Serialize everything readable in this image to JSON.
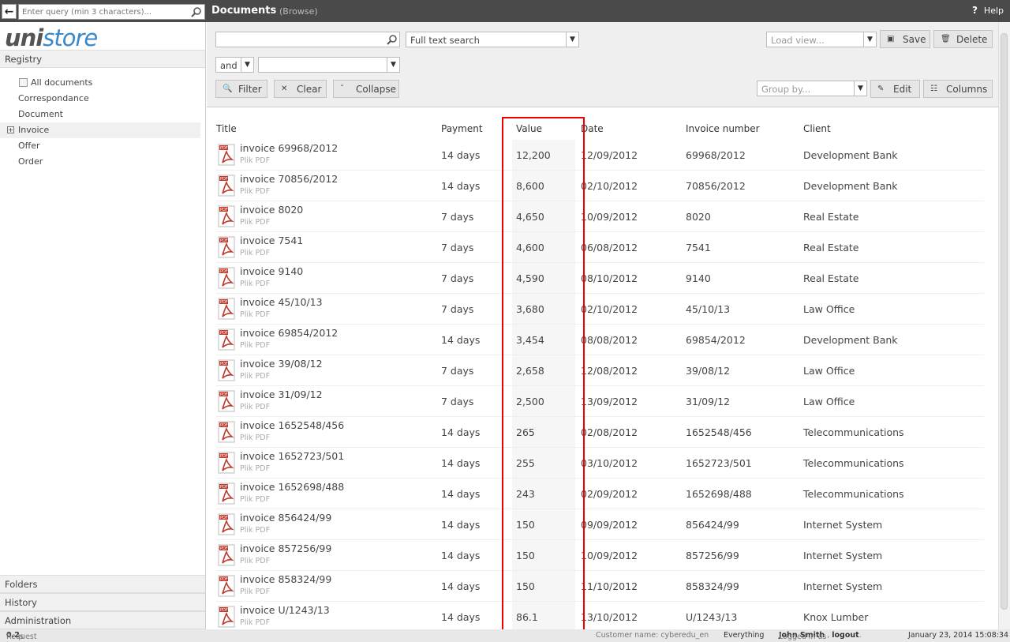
{
  "topbar": {
    "search_placeholder": "Enter query (min 3 characters)...",
    "title": "Documents",
    "subtitle": "(Browse)",
    "help": "Help"
  },
  "sidebar": {
    "logo_uni": "uni",
    "logo_store": "store",
    "registry_label": "Registry",
    "tree": [
      {
        "label": "All documents"
      },
      {
        "label": "Correspondance"
      },
      {
        "label": "Document"
      },
      {
        "label": "Invoice"
      },
      {
        "label": "Offer"
      },
      {
        "label": "Order"
      }
    ],
    "folders_label": "Folders",
    "history_label": "History",
    "administration_label": "Administration"
  },
  "toolbar": {
    "search_mode": "Full text search",
    "operator": "and",
    "filter_label": "Filter",
    "clear_label": "Clear",
    "collapse_label": "Collapse",
    "load_view_placeholder": "Load view...",
    "save_label": "Save",
    "delete_label": "Delete",
    "group_by_placeholder": "Group by...",
    "edit_label": "Edit",
    "columns_label": "Columns"
  },
  "table": {
    "columns": [
      "Title",
      "Payment",
      "Value",
      "Date",
      "Invoice number",
      "Client"
    ],
    "rows": [
      {
        "title": "invoice 69968/2012",
        "sub": "Plik PDF",
        "payment": "14 days",
        "value": "12,200",
        "date": "12/09/2012",
        "number": "69968/2012",
        "client": "Development Bank"
      },
      {
        "title": "invoice 70856/2012",
        "sub": "Plik PDF",
        "payment": "14 days",
        "value": "8,600",
        "date": "02/10/2012",
        "number": "70856/2012",
        "client": "Development Bank"
      },
      {
        "title": "invoice 8020",
        "sub": "Plik PDF",
        "payment": "7 days",
        "value": "4,650",
        "date": "10/09/2012",
        "number": "8020",
        "client": "Real Estate"
      },
      {
        "title": "invoice 7541",
        "sub": "Plik PDF",
        "payment": "7 days",
        "value": "4,600",
        "date": "06/08/2012",
        "number": "7541",
        "client": "Real Estate"
      },
      {
        "title": "invoice 9140",
        "sub": "Plik PDF",
        "payment": "7 days",
        "value": "4,590",
        "date": "08/10/2012",
        "number": "9140",
        "client": "Real Estate"
      },
      {
        "title": "invoice 45/10/13",
        "sub": "Plik PDF",
        "payment": "7 days",
        "value": "3,680",
        "date": "02/10/2012",
        "number": "45/10/13",
        "client": "Law Office"
      },
      {
        "title": "invoice 69854/2012",
        "sub": "Plik PDF",
        "payment": "14 days",
        "value": "3,454",
        "date": "08/08/2012",
        "number": "69854/2012",
        "client": "Development Bank"
      },
      {
        "title": "invoice 39/08/12",
        "sub": "Plik PDF",
        "payment": "7 days",
        "value": "2,658",
        "date": "12/08/2012",
        "number": "39/08/12",
        "client": "Law Office"
      },
      {
        "title": "invoice 31/09/12",
        "sub": "Plik PDF",
        "payment": "7 days",
        "value": "2,500",
        "date": "13/09/2012",
        "number": "31/09/12",
        "client": "Law Office"
      },
      {
        "title": "invoice 1652548/456",
        "sub": "Plik PDF",
        "payment": "14 days",
        "value": "265",
        "date": "02/08/2012",
        "number": "1652548/456",
        "client": "Telecommunications"
      },
      {
        "title": "invoice 1652723/501",
        "sub": "Plik PDF",
        "payment": "14 days",
        "value": "255",
        "date": "03/10/2012",
        "number": "1652723/501",
        "client": "Telecommunications"
      },
      {
        "title": "invoice 1652698/488",
        "sub": "Plik PDF",
        "payment": "14 days",
        "value": "243",
        "date": "02/09/2012",
        "number": "1652698/488",
        "client": "Telecommunications"
      },
      {
        "title": "invoice 856424/99",
        "sub": "Plik PDF",
        "payment": "14 days",
        "value": "150",
        "date": "09/09/2012",
        "number": "856424/99",
        "client": "Internet System"
      },
      {
        "title": "invoice 857256/99",
        "sub": "Plik PDF",
        "payment": "14 days",
        "value": "150",
        "date": "10/09/2012",
        "number": "857256/99",
        "client": "Internet System"
      },
      {
        "title": "invoice 858324/99",
        "sub": "Plik PDF",
        "payment": "14 days",
        "value": "150",
        "date": "11/10/2012",
        "number": "858324/99",
        "client": "Internet System"
      },
      {
        "title": "invoice U/1243/13",
        "sub": "Plik PDF",
        "payment": "14 days",
        "value": "86.1",
        "date": "13/10/2012",
        "number": "U/1243/13",
        "client": "Knox Lumber"
      }
    ]
  },
  "status": {
    "request_prefix": "Request in",
    "request_time": "0.2",
    "request_suffix": "s",
    "customer": "Customer name: cyberedu_en",
    "scope": "Everything",
    "logged_prefix": "Logged in as",
    "user": "John Smith",
    "logout": "logout",
    "datetime": "January 23, 2014 15:08:34"
  },
  "colors": {
    "topbar": "#4a4a4a",
    "brand_blue": "#3a88c8",
    "highlight": "#e00000"
  }
}
